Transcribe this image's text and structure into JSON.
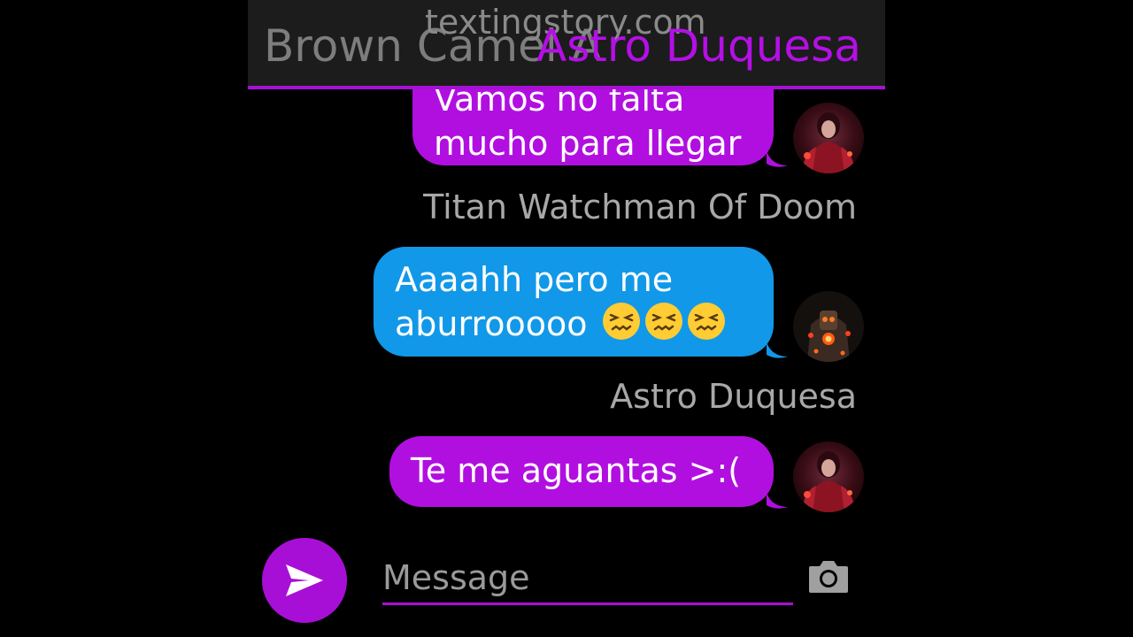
{
  "watermark": "textingstory.com",
  "header": {
    "previous_title": "Brown Camel A",
    "title": "Astro Duquesa"
  },
  "messages": [
    {
      "sender": "",
      "text_line1": "Vamos no falta",
      "text_line2": "mucho para llegar",
      "color": "#b10fe0",
      "avatar": "astro-duquesa-avatar"
    },
    {
      "sender": "Titan Watchman Of Doom",
      "text_line1": "Aaaahh pero me",
      "text_line2": "aburrooooo",
      "emoji": "persevering-face-emoji",
      "emoji_count": 3,
      "color": "#1198e8",
      "avatar": "titan-watchman-avatar"
    },
    {
      "sender": "Astro Duquesa",
      "text_line1": "Te me aguantas >:(",
      "color": "#b10fe0",
      "avatar": "astro-duquesa-avatar"
    }
  ],
  "composer": {
    "placeholder": "Message",
    "send_icon": "send-icon",
    "camera_icon": "camera-icon"
  },
  "colors": {
    "accent": "#a80fd6",
    "header_bg": "#1c1c1c",
    "background": "#000000"
  }
}
